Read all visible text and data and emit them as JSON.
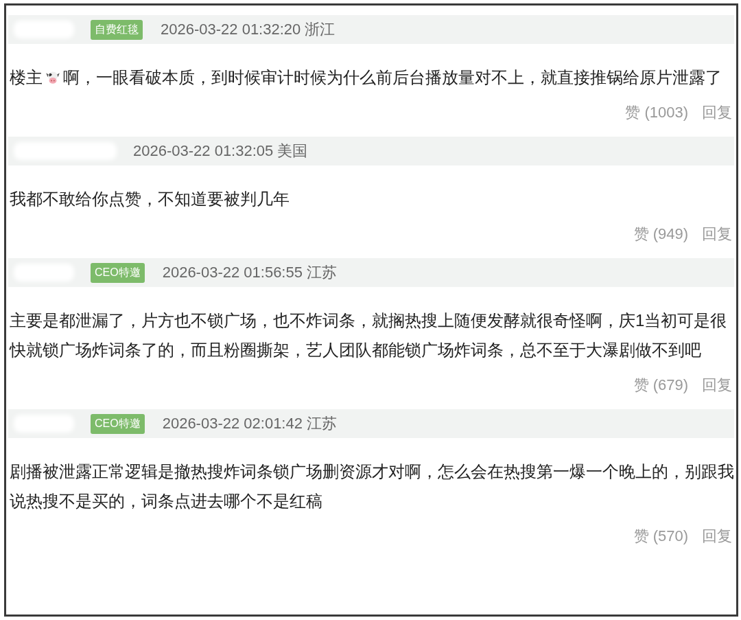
{
  "comments": [
    {
      "badge": "自费红毯",
      "timestamp": "2026-03-22 01:32:20 浙江",
      "body_parts": [
        "楼主",
        "啊，一眼看破本质，到时候审计时候为什么前后台播放量对不上，就直接推锅给原片泄露了"
      ],
      "likes": "赞 (1003)",
      "reply": "回复"
    },
    {
      "timestamp": "2026-03-22 01:32:05 美国",
      "body_parts": [
        "我都不敢给你点赞，不知道要被判几年"
      ],
      "likes": "赞 (949)",
      "reply": "回复"
    },
    {
      "badge": "CEO特邀",
      "timestamp": "2026-03-22 01:56:55 江苏",
      "body_parts": [
        "主要是都泄漏了，片方也不锁广场，也不炸词条，就搁热搜上随便发酵就很奇怪啊，庆1当初可是很快就锁广场炸词条了的，而且粉圈撕架，艺人团队都能锁广场炸词条，总不至于大瀑剧做不到吧"
      ],
      "likes": "赞 (679)",
      "reply": "回复"
    },
    {
      "badge": "CEO特邀",
      "timestamp": "2026-03-22 02:01:42 江苏",
      "body_parts": [
        "剧播被泄露正常逻辑是撤热搜炸词条锁广场删资源才对啊，怎么会在热搜第一爆一个晚上的，别跟我说热搜不是买的，词条点进去哪个不是红稿"
      ],
      "likes": "赞 (570)",
      "reply": "回复"
    }
  ]
}
